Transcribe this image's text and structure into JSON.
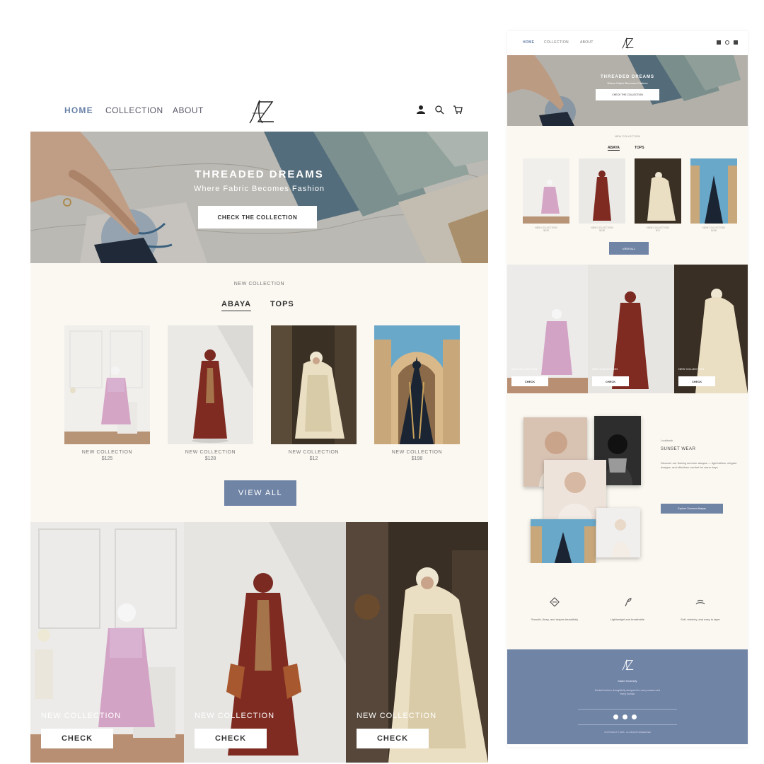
{
  "desktop": {
    "nav": {
      "home": "HOME",
      "collection": "COLLECTION",
      "about": "ABOUT"
    },
    "hero": {
      "title": "THREADED DREAMS",
      "subtitle": "Where Fabric Becomes Fashion",
      "button": "CHECK THE COLLECTION"
    },
    "collection": {
      "label": "NEW COLLECTION",
      "tabs": [
        "ABAYA",
        "TOPS"
      ],
      "products": [
        {
          "name": "NEW COLLECTION",
          "price": "$125"
        },
        {
          "name": "NEW COLLECTION",
          "price": "$128"
        },
        {
          "name": "NEW COLLECTION",
          "price": "$12"
        },
        {
          "name": "NEW COLLECTION",
          "price": "$198"
        }
      ],
      "view_all": "VIEW ALL"
    },
    "banner": [
      {
        "title": "NEW COLLECTION",
        "button": "CHECK"
      },
      {
        "title": "NEW COLLECTION",
        "button": "CHECK"
      },
      {
        "title": "NEW COLLECTION",
        "button": "CHECK"
      }
    ]
  },
  "mobile": {
    "nav": {
      "home": "HOME",
      "collection": "COLLECTION",
      "about": "ABOUT"
    },
    "hero": {
      "title": "THREADED DREAMS",
      "subtitle": "Where Fabric Becomes Fashion",
      "button": "CHECK THE COLLECTION"
    },
    "collection": {
      "label": "NEW COLLECTION",
      "tabs": [
        "ABAYA",
        "TOPS"
      ],
      "products": [
        {
          "name": "NEW COLLECTION",
          "price": "$125"
        },
        {
          "name": "NEW COLLECTION",
          "price": "$128"
        },
        {
          "name": "NEW COLLECTION",
          "price": "$12"
        },
        {
          "name": "NEW COLLECTION",
          "price": "$198"
        }
      ],
      "view_all": "VIEW ALL"
    },
    "banner": [
      {
        "title": "NEW COLLECTION",
        "button": "CHECK"
      },
      {
        "title": "NEW COLLECTION",
        "button": "CHECK"
      },
      {
        "title": "NEW COLLECTION",
        "button": "CHECK"
      }
    ],
    "lookbook": {
      "overline": "Lookbook",
      "title": "SUNSET WEAR",
      "text": "Discover our flowing summer abayas — light fabrics, elegant designs, and effortless comfort for warm days",
      "button": "Explore Summer Abayas"
    },
    "features": [
      "Smooth, flowy, and drapes beautifully",
      "Lightweight and breathable",
      "Soft, stretchy, and easy to layer"
    ],
    "footer": {
      "brand": "Made Modestly",
      "text": "Modest fashion, thoughtfully designed for every season and every woman",
      "copyright": "COPYRIGHT © 2025 · ALL RIGHTS RESERVED"
    }
  },
  "colors": {
    "accent": "#7084a6",
    "cream": "#fbf8f1",
    "nav_active": "#6a82a8"
  }
}
